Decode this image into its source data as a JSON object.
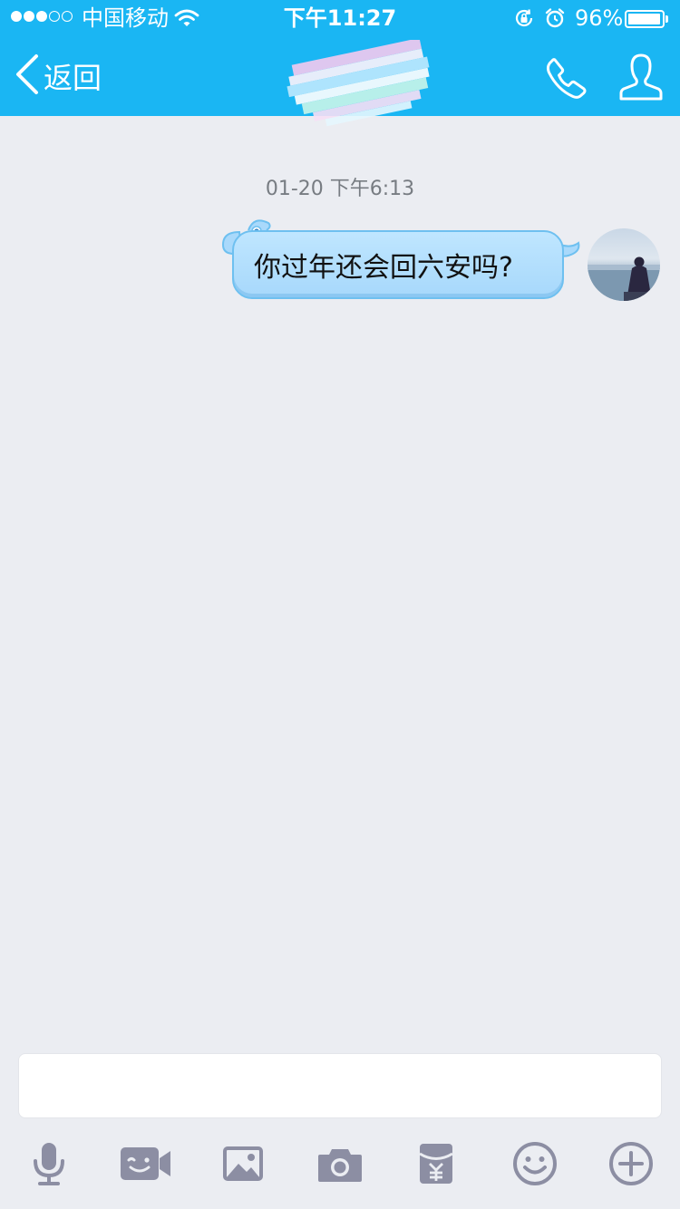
{
  "status_bar": {
    "carrier": "中国移动",
    "time": "下午11:27",
    "battery_percent": "96%",
    "battery_level": 0.96,
    "signal_bars_filled": 3,
    "signal_bars_total": 5
  },
  "nav": {
    "back_label": "返回"
  },
  "chat": {
    "timestamp": "01-20 下午6:13",
    "messages": [
      {
        "sender": "self",
        "text": "你过年还会回六安吗?"
      }
    ]
  },
  "input": {
    "value": "",
    "placeholder": ""
  },
  "toolbar": {
    "icons": [
      "microphone-icon",
      "video-call-icon",
      "image-icon",
      "camera-icon",
      "red-packet-icon",
      "emoji-icon",
      "plus-icon"
    ]
  },
  "colors": {
    "nav_background": "#1ab6f3",
    "chat_background": "#ebedf2",
    "bubble_fill": "#a7d8fb",
    "bubble_border": "#6ec0f0",
    "toolbar_icon": "#8c8ea3",
    "timestamp_text": "#777c82"
  }
}
